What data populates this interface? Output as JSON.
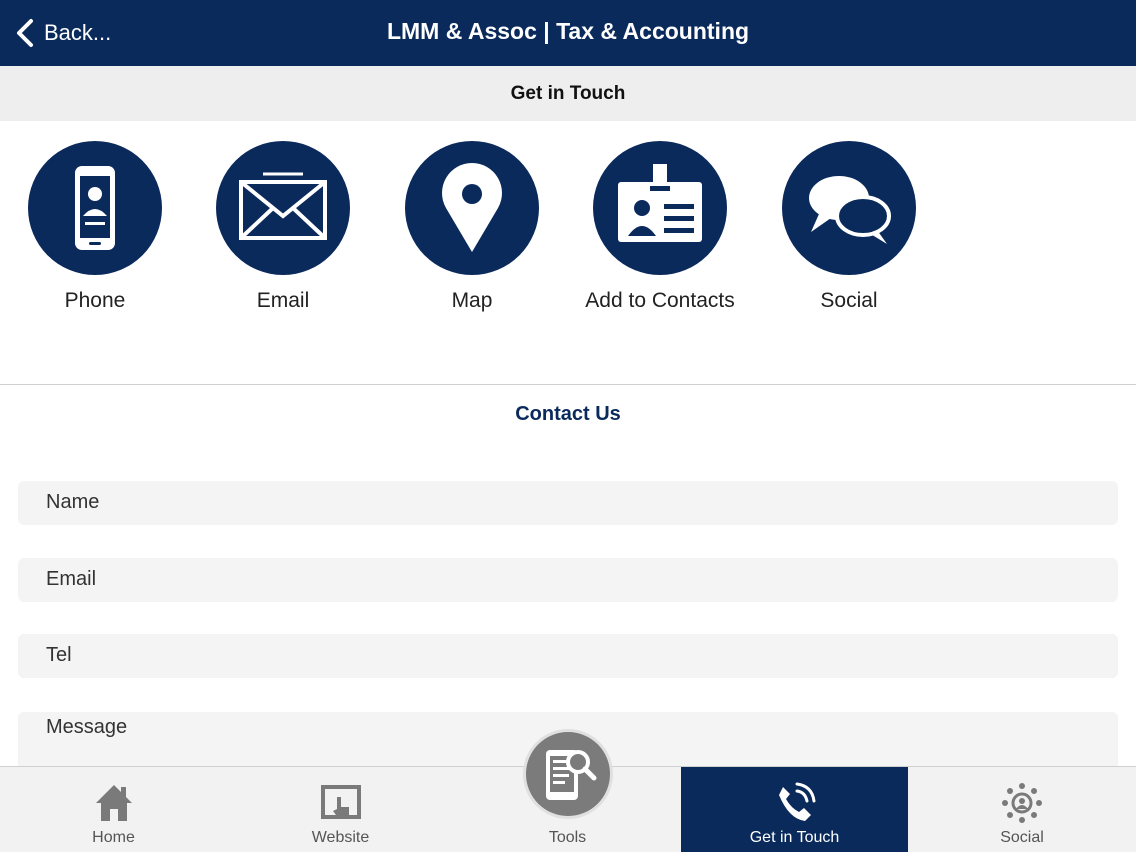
{
  "header": {
    "back_label": "Back...",
    "title": "LMM & Assoc | Tax & Accounting"
  },
  "section": {
    "title": "Get in Touch"
  },
  "actions": [
    {
      "label": "Phone",
      "icon": "phone-icon"
    },
    {
      "label": "Email",
      "icon": "envelope-icon"
    },
    {
      "label": "Map",
      "icon": "map-pin-icon"
    },
    {
      "label": "Add to Contacts",
      "icon": "id-card-icon"
    },
    {
      "label": "Social",
      "icon": "chat-bubbles-icon"
    }
  ],
  "form": {
    "title": "Contact Us",
    "fields": [
      {
        "placeholder": "Name"
      },
      {
        "placeholder": "Email"
      },
      {
        "placeholder": "Tel"
      },
      {
        "placeholder": "Message"
      }
    ]
  },
  "tabbar": {
    "items": [
      {
        "label": "Home",
        "icon": "home-icon"
      },
      {
        "label": "Website",
        "icon": "website-icon"
      },
      {
        "label": "Tools",
        "icon": "tools-icon"
      },
      {
        "label": "Get in Touch",
        "icon": "phone-call-icon",
        "active": true
      },
      {
        "label": "Social",
        "icon": "social-network-icon"
      }
    ]
  },
  "colors": {
    "brand": "#0b2a5c",
    "tab_bar": "#f2f2f2",
    "section_bar": "#eeeeee",
    "field_bg": "#f4f4f4"
  }
}
